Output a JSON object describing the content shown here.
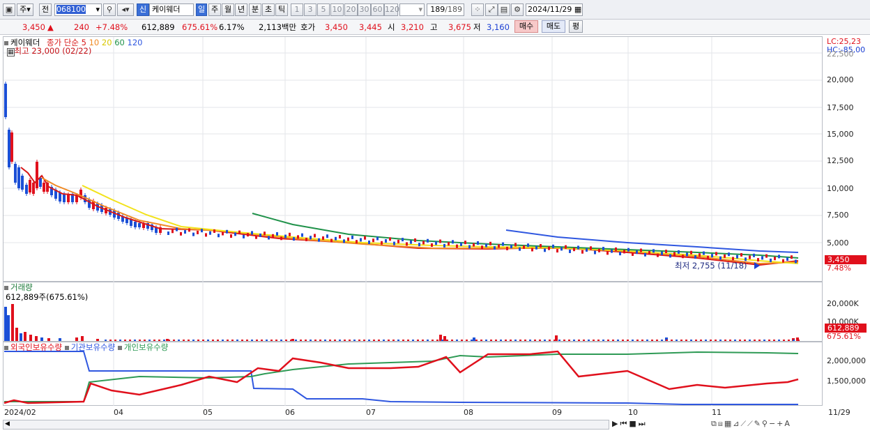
{
  "toolbar": {
    "period_main": "주",
    "prev_label": "전",
    "code": "068100",
    "new_badge": "신",
    "stock_name": "케이웨더",
    "periods": [
      "일",
      "주",
      "월",
      "년",
      "분",
      "초",
      "틱"
    ],
    "intervals": [
      "1",
      "3",
      "5",
      "10",
      "20",
      "30",
      "60",
      "120"
    ],
    "count": "189",
    "count_total": "/189",
    "date": "2024/11/29"
  },
  "quote": {
    "price": "3,450",
    "arrow": "▲",
    "change": "240",
    "change_pct": "+7.48%",
    "volume": "612,889",
    "volume_pct": "675.61%",
    "turnover": "6.17%",
    "amount": "2,113백만",
    "bid_label": "호가",
    "bid": "3,450",
    "ask": "3,445",
    "open_label": "시",
    "open": "3,210",
    "high_label": "고",
    "high": "3,675",
    "low_label": "저",
    "low": "3,160",
    "buy_label": "매수",
    "sell_label": "매도",
    "extra_label": "평"
  },
  "price_panel": {
    "name": "케이웨더",
    "ma_label": "종가 단순",
    "ma_periods": [
      "5",
      "10",
      "20",
      "60",
      "120"
    ],
    "high_note": "최고 23,000 (02/22)",
    "low_note": "최저 2,755 (11/18)",
    "lc": "LC:25,23",
    "hc": "HC:-85,00",
    "yticks": [
      "22,500",
      "20,000",
      "17,500",
      "15,000",
      "12,500",
      "10,000",
      "7,500",
      "5,000"
    ],
    "last_tag": "3,450",
    "last_pct": "7.48%"
  },
  "volume_panel": {
    "title": "거래량",
    "value_note": "612,889주(675.61%)",
    "yticks": [
      "20,000K",
      "10,000K"
    ],
    "last_tag": "612,889",
    "last_pct": "675.61%"
  },
  "holding_panel": {
    "series": [
      "외국인보유수량",
      "기관보유수량",
      "개인보유수량"
    ],
    "yticks": [
      "2,000,000",
      "1,500,000"
    ]
  },
  "xaxis": {
    "labels": [
      "2024/02",
      "04",
      "05",
      "06",
      "07",
      "08",
      "09",
      "10",
      "11"
    ],
    "end_label": "11/29"
  },
  "colors": {
    "up": "#e0101c",
    "down": "#1b4fd6",
    "ma5": "#d81818",
    "ma10": "#f08a24",
    "ma20": "#f2e21a",
    "ma60": "#20924a",
    "ma120": "#2f57e0",
    "foreign": "#e0101c",
    "inst": "#2f57e0",
    "indiv": "#2e9a55"
  }
}
